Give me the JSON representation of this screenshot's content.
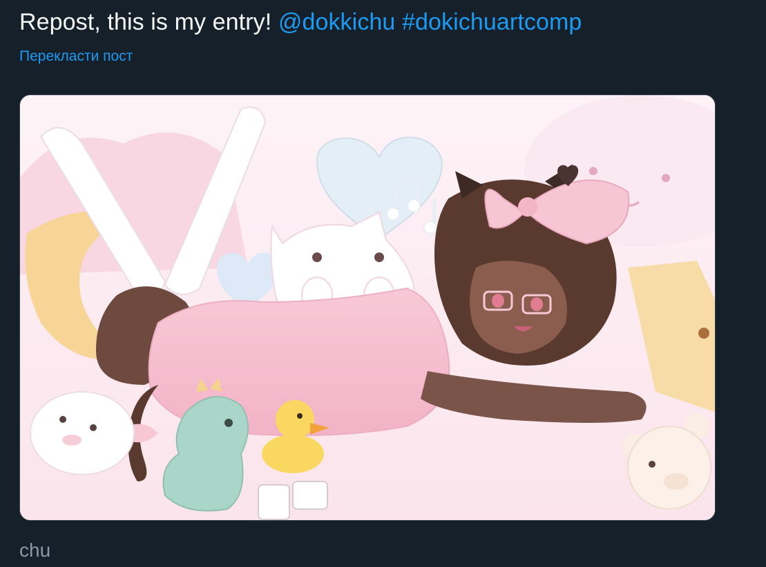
{
  "post": {
    "text": "Repost, this is my entry! ",
    "mention": "@dokkichu",
    "space": " ",
    "hashtag": "#dokichuartcomp",
    "translate_label": "Перекласти пост"
  },
  "media": {
    "alt": "Anime-style illustration of a girl with a pink bow lying on pink bedding surrounded by plush toys",
    "icons": [
      "music-note-icon",
      "heart-icon"
    ]
  },
  "below": {
    "text": "chu"
  },
  "colors": {
    "background": "#15202b",
    "text": "#f7f9f9",
    "link": "#1d9bf0",
    "muted": "#8b98a5"
  }
}
